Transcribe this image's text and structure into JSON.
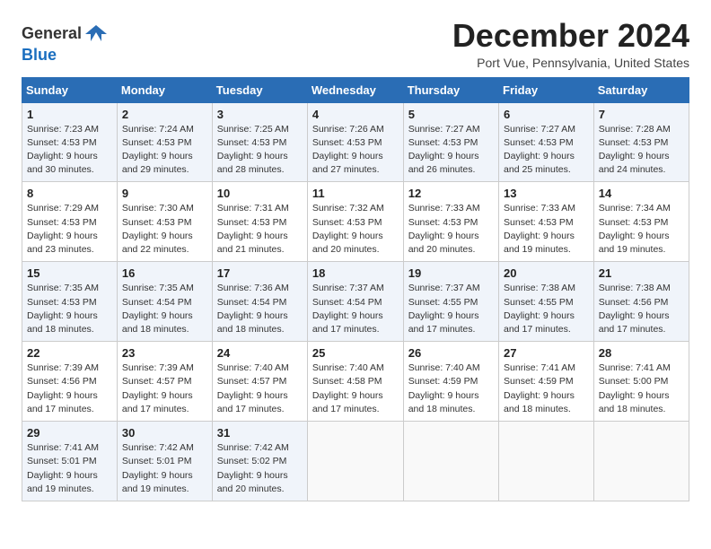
{
  "header": {
    "logo_line1": "General",
    "logo_line2": "Blue",
    "month_title": "December 2024",
    "location": "Port Vue, Pennsylvania, United States"
  },
  "weekdays": [
    "Sunday",
    "Monday",
    "Tuesday",
    "Wednesday",
    "Thursday",
    "Friday",
    "Saturday"
  ],
  "weeks": [
    [
      {
        "day": "1",
        "info": "Sunrise: 7:23 AM\nSunset: 4:53 PM\nDaylight: 9 hours\nand 30 minutes."
      },
      {
        "day": "2",
        "info": "Sunrise: 7:24 AM\nSunset: 4:53 PM\nDaylight: 9 hours\nand 29 minutes."
      },
      {
        "day": "3",
        "info": "Sunrise: 7:25 AM\nSunset: 4:53 PM\nDaylight: 9 hours\nand 28 minutes."
      },
      {
        "day": "4",
        "info": "Sunrise: 7:26 AM\nSunset: 4:53 PM\nDaylight: 9 hours\nand 27 minutes."
      },
      {
        "day": "5",
        "info": "Sunrise: 7:27 AM\nSunset: 4:53 PM\nDaylight: 9 hours\nand 26 minutes."
      },
      {
        "day": "6",
        "info": "Sunrise: 7:27 AM\nSunset: 4:53 PM\nDaylight: 9 hours\nand 25 minutes."
      },
      {
        "day": "7",
        "info": "Sunrise: 7:28 AM\nSunset: 4:53 PM\nDaylight: 9 hours\nand 24 minutes."
      }
    ],
    [
      {
        "day": "8",
        "info": "Sunrise: 7:29 AM\nSunset: 4:53 PM\nDaylight: 9 hours\nand 23 minutes."
      },
      {
        "day": "9",
        "info": "Sunrise: 7:30 AM\nSunset: 4:53 PM\nDaylight: 9 hours\nand 22 minutes."
      },
      {
        "day": "10",
        "info": "Sunrise: 7:31 AM\nSunset: 4:53 PM\nDaylight: 9 hours\nand 21 minutes."
      },
      {
        "day": "11",
        "info": "Sunrise: 7:32 AM\nSunset: 4:53 PM\nDaylight: 9 hours\nand 20 minutes."
      },
      {
        "day": "12",
        "info": "Sunrise: 7:33 AM\nSunset: 4:53 PM\nDaylight: 9 hours\nand 20 minutes."
      },
      {
        "day": "13",
        "info": "Sunrise: 7:33 AM\nSunset: 4:53 PM\nDaylight: 9 hours\nand 19 minutes."
      },
      {
        "day": "14",
        "info": "Sunrise: 7:34 AM\nSunset: 4:53 PM\nDaylight: 9 hours\nand 19 minutes."
      }
    ],
    [
      {
        "day": "15",
        "info": "Sunrise: 7:35 AM\nSunset: 4:53 PM\nDaylight: 9 hours\nand 18 minutes."
      },
      {
        "day": "16",
        "info": "Sunrise: 7:35 AM\nSunset: 4:54 PM\nDaylight: 9 hours\nand 18 minutes."
      },
      {
        "day": "17",
        "info": "Sunrise: 7:36 AM\nSunset: 4:54 PM\nDaylight: 9 hours\nand 18 minutes."
      },
      {
        "day": "18",
        "info": "Sunrise: 7:37 AM\nSunset: 4:54 PM\nDaylight: 9 hours\nand 17 minutes."
      },
      {
        "day": "19",
        "info": "Sunrise: 7:37 AM\nSunset: 4:55 PM\nDaylight: 9 hours\nand 17 minutes."
      },
      {
        "day": "20",
        "info": "Sunrise: 7:38 AM\nSunset: 4:55 PM\nDaylight: 9 hours\nand 17 minutes."
      },
      {
        "day": "21",
        "info": "Sunrise: 7:38 AM\nSunset: 4:56 PM\nDaylight: 9 hours\nand 17 minutes."
      }
    ],
    [
      {
        "day": "22",
        "info": "Sunrise: 7:39 AM\nSunset: 4:56 PM\nDaylight: 9 hours\nand 17 minutes."
      },
      {
        "day": "23",
        "info": "Sunrise: 7:39 AM\nSunset: 4:57 PM\nDaylight: 9 hours\nand 17 minutes."
      },
      {
        "day": "24",
        "info": "Sunrise: 7:40 AM\nSunset: 4:57 PM\nDaylight: 9 hours\nand 17 minutes."
      },
      {
        "day": "25",
        "info": "Sunrise: 7:40 AM\nSunset: 4:58 PM\nDaylight: 9 hours\nand 17 minutes."
      },
      {
        "day": "26",
        "info": "Sunrise: 7:40 AM\nSunset: 4:59 PM\nDaylight: 9 hours\nand 18 minutes."
      },
      {
        "day": "27",
        "info": "Sunrise: 7:41 AM\nSunset: 4:59 PM\nDaylight: 9 hours\nand 18 minutes."
      },
      {
        "day": "28",
        "info": "Sunrise: 7:41 AM\nSunset: 5:00 PM\nDaylight: 9 hours\nand 18 minutes."
      }
    ],
    [
      {
        "day": "29",
        "info": "Sunrise: 7:41 AM\nSunset: 5:01 PM\nDaylight: 9 hours\nand 19 minutes."
      },
      {
        "day": "30",
        "info": "Sunrise: 7:42 AM\nSunset: 5:01 PM\nDaylight: 9 hours\nand 19 minutes."
      },
      {
        "day": "31",
        "info": "Sunrise: 7:42 AM\nSunset: 5:02 PM\nDaylight: 9 hours\nand 20 minutes."
      },
      {
        "day": "",
        "info": ""
      },
      {
        "day": "",
        "info": ""
      },
      {
        "day": "",
        "info": ""
      },
      {
        "day": "",
        "info": ""
      }
    ]
  ]
}
